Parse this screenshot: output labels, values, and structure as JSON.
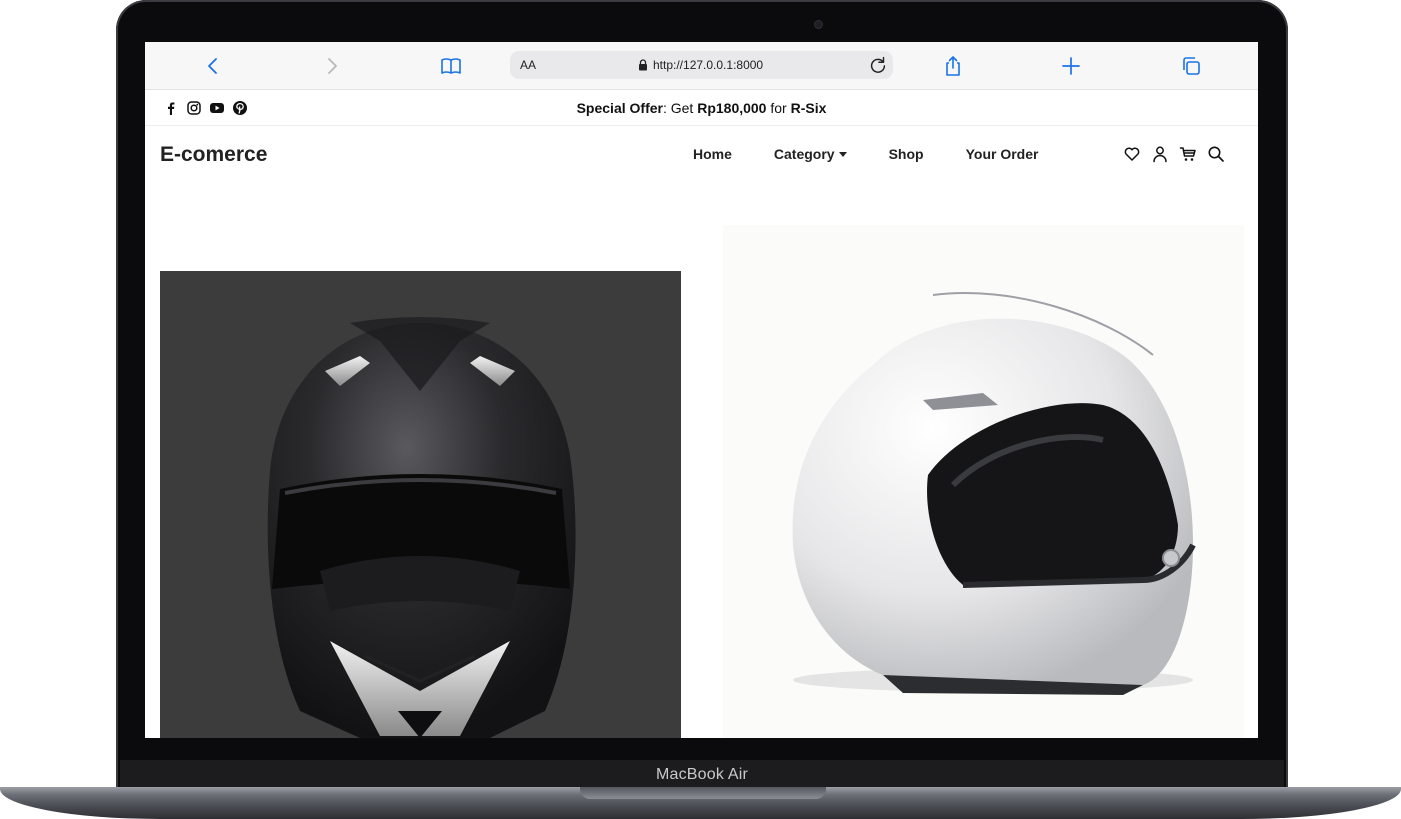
{
  "device": {
    "label": "MacBook Air"
  },
  "browser": {
    "text_size_label": "AA",
    "url": "http://127.0.0.1:8000"
  },
  "topbar": {
    "offer_prefix": "Special Offer",
    "offer_mid": ": Get ",
    "offer_price": "Rp180,000",
    "offer_for": " for ",
    "offer_product": "R-Six"
  },
  "nav": {
    "brand": "E-comerce",
    "items": [
      {
        "label": "Home"
      },
      {
        "label": "Category"
      },
      {
        "label": "Shop"
      },
      {
        "label": "Your Order"
      }
    ]
  },
  "hero": {
    "left_image": "black-full-face-helmet",
    "right_image": "white-modular-helmet"
  },
  "colors": {
    "hero_left_bg": "#3d3c3d",
    "browser_accent": "#1a73e8",
    "text": "#222222"
  }
}
